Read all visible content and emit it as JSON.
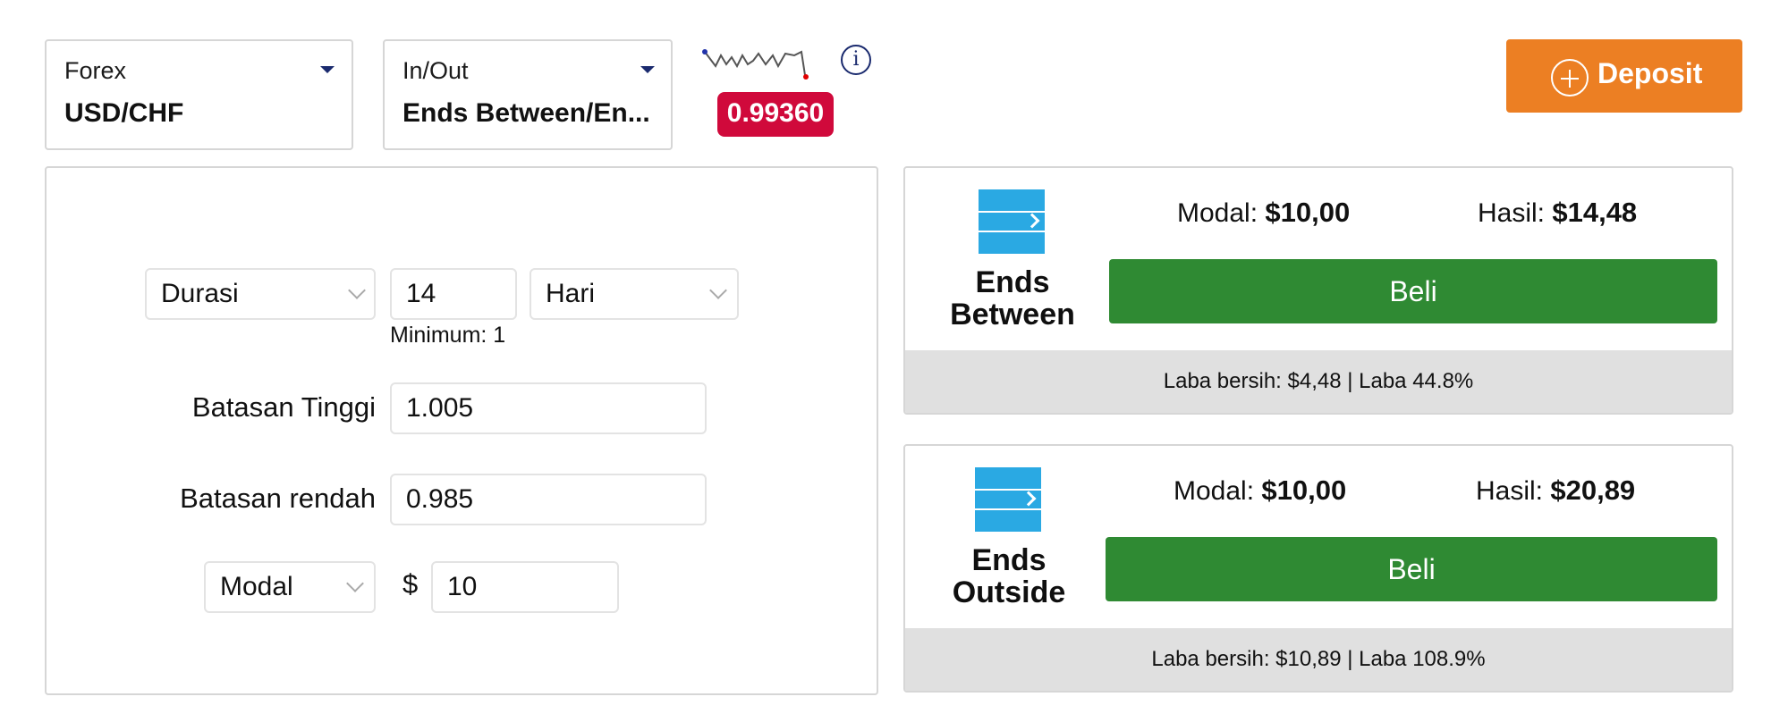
{
  "asset_selector": {
    "category": "Forex",
    "value": "USD/CHF"
  },
  "type_selector": {
    "category": "In/Out",
    "value": "Ends Between/En..."
  },
  "price": "0.99360",
  "deposit": {
    "label": "Deposit"
  },
  "form": {
    "duration": {
      "label": "Durasi",
      "value": "14",
      "unit": "Hari",
      "hint": "Minimum: 1"
    },
    "upper_limit": {
      "label": "Batasan Tinggi",
      "value": "1.005"
    },
    "lower_limit": {
      "label": "Batasan rendah",
      "value": "0.985"
    },
    "stake": {
      "label": "Modal",
      "currency": "$",
      "value": "10"
    }
  },
  "options": [
    {
      "name_line1": "Ends",
      "name_line2": "Between",
      "stake_label": "Modal:",
      "stake_value": "$10,00",
      "payout_label": "Hasil:",
      "payout_value": "$14,48",
      "buy_label": "Beli",
      "footer": "Laba bersih: $4,48 | Laba 44.8%"
    },
    {
      "name_line1": "Ends",
      "name_line2": "Outside",
      "stake_label": "Modal:",
      "stake_value": "$10,00",
      "payout_label": "Hasil:",
      "payout_value": "$20,89",
      "buy_label": "Beli",
      "footer": "Laba bersih: $10,89 | Laba 108.9%"
    }
  ],
  "colors": {
    "accent_orange": "#ec7f23",
    "price_red": "#d0093b",
    "buy_green": "#2f8a33",
    "icon_blue": "#2aa9e3"
  },
  "icons": [
    "chevron-down-icon",
    "info-icon",
    "plus-circle-icon",
    "sparkline-icon",
    "contract-type-icon"
  ]
}
